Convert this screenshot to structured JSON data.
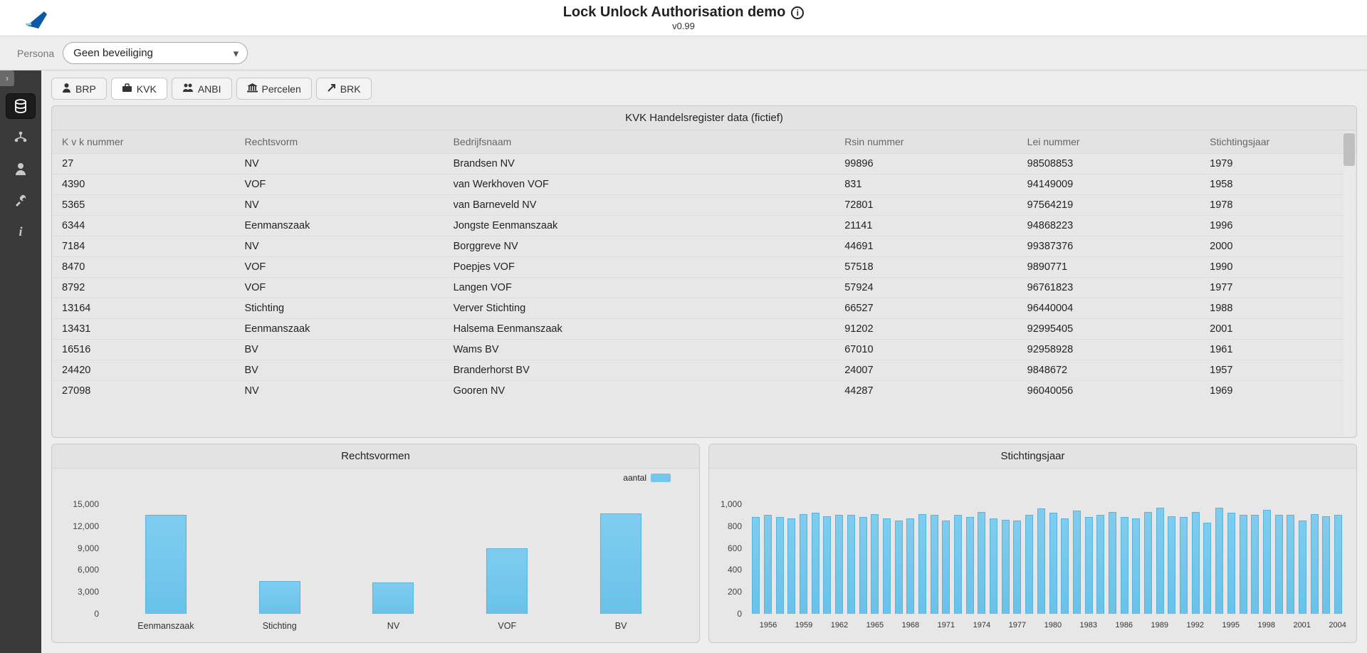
{
  "header": {
    "title": "Lock Unlock Authorisation demo",
    "version": "v0.99"
  },
  "persona": {
    "label": "Persona",
    "selected": "Geen beveiliging"
  },
  "sidebar": {
    "items": [
      {
        "name": "data-icon",
        "glyph": "≡"
      },
      {
        "name": "org-icon",
        "glyph": "⛬"
      },
      {
        "name": "user-icon",
        "glyph": "👤"
      },
      {
        "name": "tool-icon",
        "glyph": "✎"
      },
      {
        "name": "info-icon",
        "glyph": "i"
      }
    ],
    "activeIndex": 0
  },
  "tabs": [
    {
      "name": "brp",
      "label": "BRP",
      "glyph": "👤"
    },
    {
      "name": "kvk",
      "label": "KVK",
      "glyph": "💼"
    },
    {
      "name": "anbi",
      "label": "ANBI",
      "glyph": "☁"
    },
    {
      "name": "percelen",
      "label": "Percelen",
      "glyph": "🏛"
    },
    {
      "name": "brk",
      "label": "BRK",
      "glyph": "↗"
    }
  ],
  "activeTabIndex": 1,
  "table": {
    "title": "KVK Handelsregister data (fictief)",
    "columns": [
      "K v k nummer",
      "Rechtsvorm",
      "Bedrijfsnaam",
      "Rsin nummer",
      "Lei nummer",
      "Stichtingsjaar"
    ],
    "rows": [
      [
        "27",
        "NV",
        "Brandsen NV",
        "99896",
        "98508853",
        "1979"
      ],
      [
        "4390",
        "VOF",
        "van Werkhoven VOF",
        "831",
        "94149009",
        "1958"
      ],
      [
        "5365",
        "NV",
        "van Barneveld NV",
        "72801",
        "97564219",
        "1978"
      ],
      [
        "6344",
        "Eenmanszaak",
        "Jongste Eenmanszaak",
        "21141",
        "94868223",
        "1996"
      ],
      [
        "7184",
        "NV",
        "Borggreve NV",
        "44691",
        "99387376",
        "2000"
      ],
      [
        "8470",
        "VOF",
        "Poepjes VOF",
        "57518",
        "9890771",
        "1990"
      ],
      [
        "8792",
        "VOF",
        "Langen VOF",
        "57924",
        "96761823",
        "1977"
      ],
      [
        "13164",
        "Stichting",
        "Verver Stichting",
        "66527",
        "96440004",
        "1988"
      ],
      [
        "13431",
        "Eenmanszaak",
        "Halsema Eenmanszaak",
        "91202",
        "92995405",
        "2001"
      ],
      [
        "16516",
        "BV",
        "Wams BV",
        "67010",
        "92958928",
        "1961"
      ],
      [
        "24420",
        "BV",
        "Branderhorst BV",
        "24007",
        "9848672",
        "1957"
      ],
      [
        "27098",
        "NV",
        "Gooren NV",
        "44287",
        "96040056",
        "1969"
      ]
    ]
  },
  "chart_data": [
    {
      "type": "bar",
      "title": "Rechtsvormen",
      "legend": "aantal",
      "categories": [
        "Eenmanszaak",
        "Stichting",
        "NV",
        "VOF",
        "BV"
      ],
      "values": [
        13500,
        4500,
        4300,
        9000,
        13700
      ],
      "ylim": [
        0,
        15000
      ],
      "yticks": [
        0,
        3000,
        6000,
        9000,
        12000,
        15000
      ],
      "ytick_labels": [
        "0",
        "3,000",
        "6,000",
        "9,000",
        "12,000",
        "15,000"
      ]
    },
    {
      "type": "bar",
      "title": "Stichtingsjaar",
      "x": [
        1955,
        1956,
        1957,
        1958,
        1959,
        1960,
        1961,
        1962,
        1963,
        1964,
        1965,
        1966,
        1967,
        1968,
        1969,
        1970,
        1971,
        1972,
        1973,
        1974,
        1975,
        1976,
        1977,
        1978,
        1979,
        1980,
        1981,
        1982,
        1983,
        1984,
        1985,
        1986,
        1987,
        1988,
        1989,
        1990,
        1991,
        1992,
        1993,
        1994,
        1995,
        1996,
        1997,
        1998,
        1999,
        2000,
        2001,
        2002,
        2003,
        2004
      ],
      "values": [
        880,
        900,
        880,
        870,
        910,
        920,
        890,
        900,
        900,
        880,
        910,
        870,
        850,
        870,
        910,
        900,
        850,
        900,
        880,
        930,
        870,
        860,
        850,
        900,
        960,
        920,
        870,
        940,
        880,
        900,
        930,
        880,
        870,
        930,
        970,
        890,
        880,
        930,
        830,
        970,
        920,
        900,
        900,
        950,
        900,
        900,
        850,
        910,
        890,
        900
      ],
      "ylim": [
        0,
        1000
      ],
      "yticks": [
        0,
        200,
        400,
        600,
        800,
        1000
      ],
      "ytick_labels": [
        "0",
        "200",
        "400",
        "600",
        "800",
        "1,000"
      ],
      "xtick_labels": [
        1956,
        1959,
        1962,
        1965,
        1968,
        1971,
        1974,
        1977,
        1980,
        1983,
        1986,
        1989,
        1992,
        1995,
        1998,
        2001,
        2004
      ]
    }
  ]
}
